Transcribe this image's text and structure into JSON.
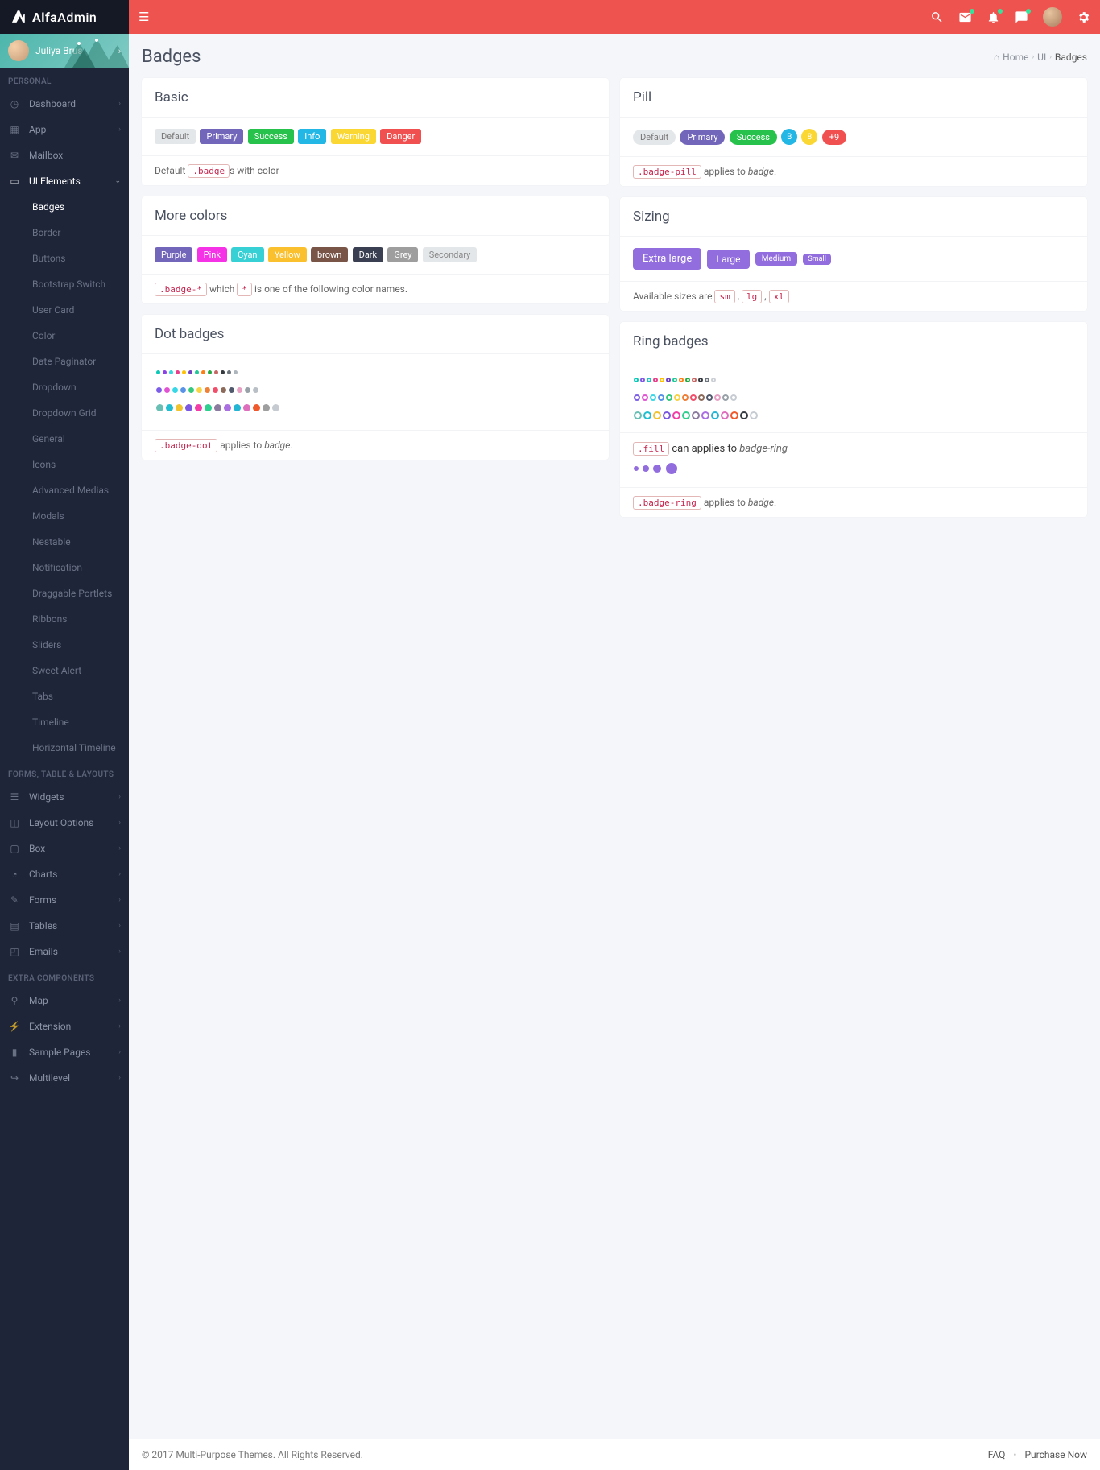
{
  "brand": {
    "bold": "Alfa",
    "rest": "Admin"
  },
  "user": {
    "name": "Juliya Brus"
  },
  "sidebar": {
    "headers": {
      "personal": "PERSONAL",
      "forms": "FORMS, TABLE & LAYOUTS",
      "extra": "EXTRA COMPONENTS"
    },
    "personal": [
      {
        "label": "Dashboard"
      },
      {
        "label": "App"
      },
      {
        "label": "Mailbox"
      },
      {
        "label": "UI Elements"
      }
    ],
    "uiElements": [
      {
        "label": "Badges"
      },
      {
        "label": "Border"
      },
      {
        "label": "Buttons"
      },
      {
        "label": "Bootstrap Switch"
      },
      {
        "label": "User Card"
      },
      {
        "label": "Color"
      },
      {
        "label": "Date Paginator"
      },
      {
        "label": "Dropdown"
      },
      {
        "label": "Dropdown Grid"
      },
      {
        "label": "General"
      },
      {
        "label": "Icons"
      },
      {
        "label": "Advanced Medias"
      },
      {
        "label": "Modals"
      },
      {
        "label": "Nestable"
      },
      {
        "label": "Notification"
      },
      {
        "label": "Draggable Portlets"
      },
      {
        "label": "Ribbons"
      },
      {
        "label": "Sliders"
      },
      {
        "label": "Sweet Alert"
      },
      {
        "label": "Tabs"
      },
      {
        "label": "Timeline"
      },
      {
        "label": "Horizontal Timeline"
      }
    ],
    "forms": [
      {
        "label": "Widgets"
      },
      {
        "label": "Layout Options"
      },
      {
        "label": "Box"
      },
      {
        "label": "Charts"
      },
      {
        "label": "Forms"
      },
      {
        "label": "Tables"
      },
      {
        "label": "Emails"
      }
    ],
    "extra": [
      {
        "label": "Map"
      },
      {
        "label": "Extension"
      },
      {
        "label": "Sample Pages"
      },
      {
        "label": "Multilevel"
      }
    ]
  },
  "page": {
    "title": "Badges"
  },
  "breadcrumbs": {
    "home": "Home",
    "ui": "UI",
    "current": "Badges"
  },
  "boxes": {
    "basic": {
      "title": "Basic",
      "items": [
        "Default",
        "Primary",
        "Success",
        "Info",
        "Warning",
        "Danger"
      ],
      "footer_pre": "Default ",
      "footer_code": ".badge",
      "footer_post": "s with color"
    },
    "pill": {
      "title": "Pill",
      "items": [
        "Default",
        "Primary",
        "Success",
        "B",
        "8",
        "+9"
      ],
      "footer_code": ".badge-pill",
      "footer_mid": " applies to ",
      "footer_em": "badge",
      "footer_post": "."
    },
    "more": {
      "title": "More colors",
      "items": [
        "Purple",
        "Pink",
        "Cyan",
        "Yellow",
        "brown",
        "Dark",
        "Grey",
        "Secondary"
      ],
      "footer_code": ".badge-*",
      "footer_mid": " which ",
      "footer_code2": "*",
      "footer_post": " is one of the following color names."
    },
    "sizing": {
      "title": "Sizing",
      "items": [
        "Extra large",
        "Large",
        "Medium",
        "Small"
      ],
      "footer_pre": "Available sizes are ",
      "codes": [
        "sm",
        "lg",
        "xl"
      ]
    },
    "dot": {
      "title": "Dot badges",
      "footer_code": ".badge-dot",
      "footer_mid": " applies to ",
      "footer_em": "badge",
      "footer_post": "."
    },
    "ring": {
      "title": "Ring badges",
      "fill_code": ".fill",
      "fill_mid": " can applies to ",
      "fill_em": "badge-ring",
      "footer_code": ".badge-ring",
      "footer_mid": " applies to ",
      "footer_em": "badge",
      "footer_post": "."
    }
  },
  "palette": {
    "row1_colors": [
      "#0bc9b6",
      "#8a43e7",
      "#36d5e0",
      "#e83e8c",
      "#ffc107",
      "#6f42c1",
      "#20c997",
      "#fd7e14",
      "#28a745",
      "#c56765",
      "#343a40",
      "#6c757d",
      "#adb5bd"
    ],
    "row2_colors": [
      "#7b5de8",
      "#e253d4",
      "#38d7e7",
      "#5893e8",
      "#36c97e",
      "#f7d346",
      "#f18037",
      "#f14e6b",
      "#8c6b5a",
      "#51596c",
      "#e6a0c3",
      "#98a0a8",
      "#b8bfc6"
    ],
    "row3_colors": [
      "#6abfb5",
      "#21bfcf",
      "#f0c330",
      "#7c57e0",
      "#f23ea6",
      "#2fcf90",
      "#8a7b9f",
      "#aa6fe0",
      "#24b4d4",
      "#de6fbd",
      "#f0592b",
      "#9e9e9e",
      "#c5cbd1"
    ],
    "ring1_colors": [
      "#0bc9b6",
      "#8257e5",
      "#22c3c3",
      "#e83e8c",
      "#ffc107",
      "#6f42c1",
      "#20c997",
      "#fd7e14",
      "#28a745",
      "#c56765",
      "#343a40",
      "#6c757d",
      "#ccd0d6"
    ],
    "ring2_colors": [
      "#7b5de8",
      "#e253d4",
      "#38d7e7",
      "#5893e8",
      "#36c97e",
      "#f7d346",
      "#f18037",
      "#f14e6b",
      "#8c6b5a",
      "#51596c",
      "#e6a0c3",
      "#98a0a8",
      "#c7ccd2"
    ],
    "ring3_colors": [
      "#6abfb5",
      "#21bfcf",
      "#f0c330",
      "#7c57e0",
      "#f23ea6",
      "#2fcf90",
      "#8a7b9f",
      "#aa6fe0",
      "#24b4d4",
      "#de6fbd",
      "#f0592b",
      "#343a40",
      "#c7ccd2"
    ]
  },
  "footer": {
    "copy": "© 2017 Multi-Purpose Themes. All Rights Reserved.",
    "faq": "FAQ",
    "purchase": "Purchase Now"
  }
}
